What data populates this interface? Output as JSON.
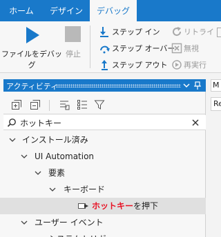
{
  "tabs": [
    {
      "label": "ホーム"
    },
    {
      "label": "デザイン"
    },
    {
      "label": "デバッグ"
    }
  ],
  "ribbon": {
    "debug_file": "ファイルをデバッグ",
    "stop": "停止",
    "step_into": "ステップ イン",
    "step_over": "ステップ オーバー",
    "step_out": "ステップ アウト",
    "retry": "リトライ",
    "ignore": "無視",
    "restart": "再実行"
  },
  "panel": {
    "title": "アクティビティ",
    "search_value": "ホットキー"
  },
  "tree": {
    "installed": "インストール済み",
    "ui_automation": "UI Automation",
    "element": "要素",
    "keyboard": "キーボード",
    "hotkey_highlight": "ホットキー",
    "hotkey_rest": "を押下",
    "user_events": "ユーザー イベント",
    "system_trigger": "システムトリガー"
  },
  "right": {
    "tab_fragment": "M",
    "cell_fragment": "Re"
  },
  "colors": {
    "accent": "#1979ca",
    "highlight_text": "#e81123",
    "disabled": "#9a9a9a"
  }
}
